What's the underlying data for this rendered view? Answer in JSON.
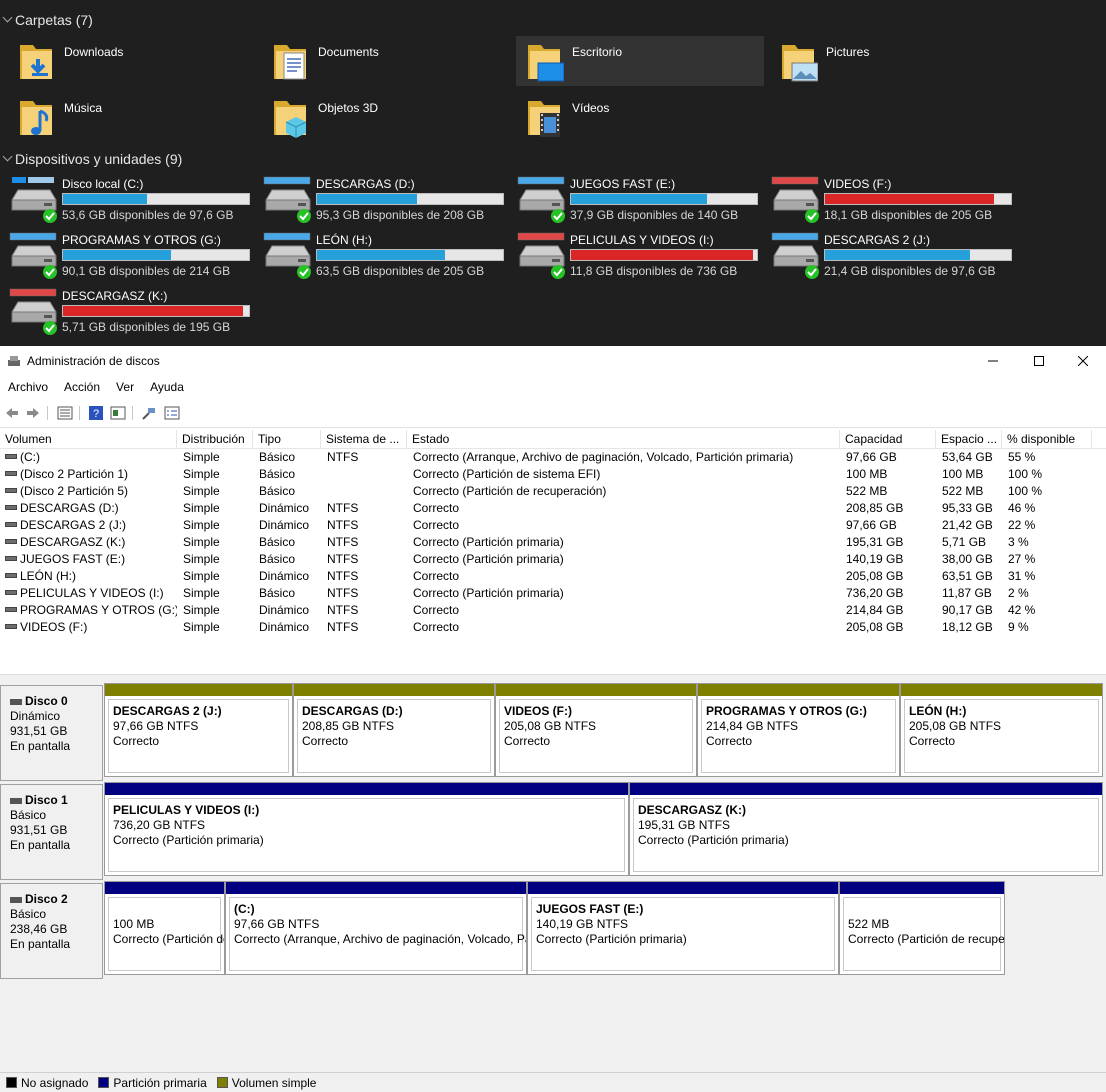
{
  "colors": {
    "bar_normal": "#26a0da",
    "bar_full": "#da2626",
    "primary_partition": "#000080",
    "simple_volume": "#808000",
    "unallocated": "#000000"
  },
  "explorer": {
    "folders_header": "Carpetas (7)",
    "folders": [
      {
        "label": "Downloads",
        "icon": "downloads-folder-icon"
      },
      {
        "label": "Documents",
        "icon": "documents-folder-icon"
      },
      {
        "label": "Escritorio",
        "icon": "desktop-folder-icon"
      },
      {
        "label": "Pictures",
        "icon": "pictures-folder-icon"
      },
      {
        "label": "Música",
        "icon": "music-folder-icon"
      },
      {
        "label": "Objetos 3D",
        "icon": "3d-objects-folder-icon"
      },
      {
        "label": "Vídeos",
        "icon": "videos-folder-icon"
      }
    ],
    "drives_header": "Dispositivos y unidades (9)",
    "drives": [
      {
        "name": "Disco local (C:)",
        "free": "53,6 GB disponibles de 97,6 GB",
        "used_fraction": 0.45,
        "low": false,
        "windows": true
      },
      {
        "name": "DESCARGAS (D:)",
        "free": "95,3 GB disponibles de 208 GB",
        "used_fraction": 0.54,
        "low": false,
        "windows": false
      },
      {
        "name": "JUEGOS FAST (E:)",
        "free": "37,9 GB disponibles de 140 GB",
        "used_fraction": 0.73,
        "low": false,
        "windows": false
      },
      {
        "name": "VIDEOS (F:)",
        "free": "18,1 GB disponibles de 205 GB",
        "used_fraction": 0.91,
        "low": true,
        "windows": false
      },
      {
        "name": "PROGRAMAS Y OTROS (G:)",
        "free": "90,1 GB disponibles de 214 GB",
        "used_fraction": 0.58,
        "low": false,
        "windows": false
      },
      {
        "name": "LEÓN (H:)",
        "free": "63,5 GB disponibles de 205 GB",
        "used_fraction": 0.69,
        "low": false,
        "windows": false
      },
      {
        "name": "PELICULAS Y VIDEOS (I:)",
        "free": "11,8 GB disponibles de 736 GB",
        "used_fraction": 0.98,
        "low": true,
        "windows": false
      },
      {
        "name": "DESCARGAS 2 (J:)",
        "free": "21,4 GB disponibles de 97,6 GB",
        "used_fraction": 0.78,
        "low": false,
        "windows": false
      },
      {
        "name": "DESCARGASZ (K:)",
        "free": "5,71 GB disponibles de 195 GB",
        "used_fraction": 0.97,
        "low": true,
        "windows": false
      }
    ]
  },
  "dm": {
    "title": "Administración de discos",
    "menu": [
      "Archivo",
      "Acción",
      "Ver",
      "Ayuda"
    ],
    "columns": [
      "Volumen",
      "Distribución",
      "Tipo",
      "Sistema de ...",
      "Estado",
      "Capacidad",
      "Espacio ...",
      "% disponible"
    ],
    "rows": [
      [
        "(C:)",
        "Simple",
        "Básico",
        "NTFS",
        "Correcto (Arranque, Archivo de paginación, Volcado, Partición primaria)",
        "97,66 GB",
        "53,64 GB",
        "55 %"
      ],
      [
        "(Disco 2 Partición 1)",
        "Simple",
        "Básico",
        "",
        "Correcto (Partición de sistema EFI)",
        "100 MB",
        "100 MB",
        "100 %"
      ],
      [
        "(Disco 2 Partición 5)",
        "Simple",
        "Básico",
        "",
        "Correcto (Partición de recuperación)",
        "522 MB",
        "522 MB",
        "100 %"
      ],
      [
        "DESCARGAS (D:)",
        "Simple",
        "Dinámico",
        "NTFS",
        "Correcto",
        "208,85 GB",
        "95,33 GB",
        "46 %"
      ],
      [
        "DESCARGAS 2 (J:)",
        "Simple",
        "Dinámico",
        "NTFS",
        "Correcto",
        "97,66 GB",
        "21,42 GB",
        "22 %"
      ],
      [
        "DESCARGASZ (K:)",
        "Simple",
        "Básico",
        "NTFS",
        "Correcto (Partición primaria)",
        "195,31 GB",
        "5,71 GB",
        "3 %"
      ],
      [
        "JUEGOS FAST (E:)",
        "Simple",
        "Básico",
        "NTFS",
        "Correcto (Partición primaria)",
        "140,19 GB",
        "38,00 GB",
        "27 %"
      ],
      [
        "LEÓN (H:)",
        "Simple",
        "Dinámico",
        "NTFS",
        "Correcto",
        "205,08 GB",
        "63,51 GB",
        "31 %"
      ],
      [
        "PELICULAS Y VIDEOS (I:)",
        "Simple",
        "Básico",
        "NTFS",
        "Correcto (Partición primaria)",
        "736,20 GB",
        "11,87 GB",
        "2 %"
      ],
      [
        "PROGRAMAS Y OTROS (G:)",
        "Simple",
        "Dinámico",
        "NTFS",
        "Correcto",
        "214,84 GB",
        "90,17 GB",
        "42 %"
      ],
      [
        "VIDEOS (F:)",
        "Simple",
        "Dinámico",
        "NTFS",
        "Correcto",
        "205,08 GB",
        "18,12 GB",
        "9 %"
      ]
    ],
    "disks": [
      {
        "name": "Disco 0",
        "type": "Dinámico",
        "size": "931,51 GB",
        "status": "En pantalla",
        "partitions": [
          {
            "name": "DESCARGAS 2  (J:)",
            "size": "97,66 GB NTFS",
            "status": "Correcto",
            "kind": "simple"
          },
          {
            "name": "DESCARGAS  (D:)",
            "size": "208,85 GB NTFS",
            "status": "Correcto",
            "kind": "simple"
          },
          {
            "name": "VIDEOS  (F:)",
            "size": "205,08 GB NTFS",
            "status": "Correcto",
            "kind": "simple"
          },
          {
            "name": "PROGRAMAS Y OTROS  (G:)",
            "size": "214,84 GB NTFS",
            "status": "Correcto",
            "kind": "simple"
          },
          {
            "name": "LEÓN  (H:)",
            "size": "205,08 GB NTFS",
            "status": "Correcto",
            "kind": "simple"
          }
        ]
      },
      {
        "name": "Disco 1",
        "type": "Básico",
        "size": "931,51 GB",
        "status": "En pantalla",
        "partitions": [
          {
            "name": "PELICULAS Y VIDEOS  (I:)",
            "size": "736,20 GB NTFS",
            "status": "Correcto (Partición primaria)",
            "kind": "primary"
          },
          {
            "name": "DESCARGASZ  (K:)",
            "size": "195,31 GB NTFS",
            "status": "Correcto (Partición primaria)",
            "kind": "primary"
          }
        ]
      },
      {
        "name": "Disco 2",
        "type": "Básico",
        "size": "238,46 GB",
        "status": "En pantalla",
        "partitions": [
          {
            "name": "",
            "size": "100 MB",
            "status": "Correcto (Partición de sistema EFI)",
            "kind": "primary"
          },
          {
            "name": "(C:)",
            "size": "97,66 GB NTFS",
            "status": "Correcto (Arranque, Archivo de paginación, Volcado, Partición primaria)",
            "kind": "primary"
          },
          {
            "name": "JUEGOS FAST  (E:)",
            "size": "140,19 GB NTFS",
            "status": "Correcto (Partición primaria)",
            "kind": "primary"
          },
          {
            "name": "",
            "size": "522 MB",
            "status": "Correcto (Partición de recuperación)",
            "kind": "primary"
          }
        ]
      }
    ],
    "legend": [
      "No asignado",
      "Partición primaria",
      "Volumen simple"
    ]
  }
}
